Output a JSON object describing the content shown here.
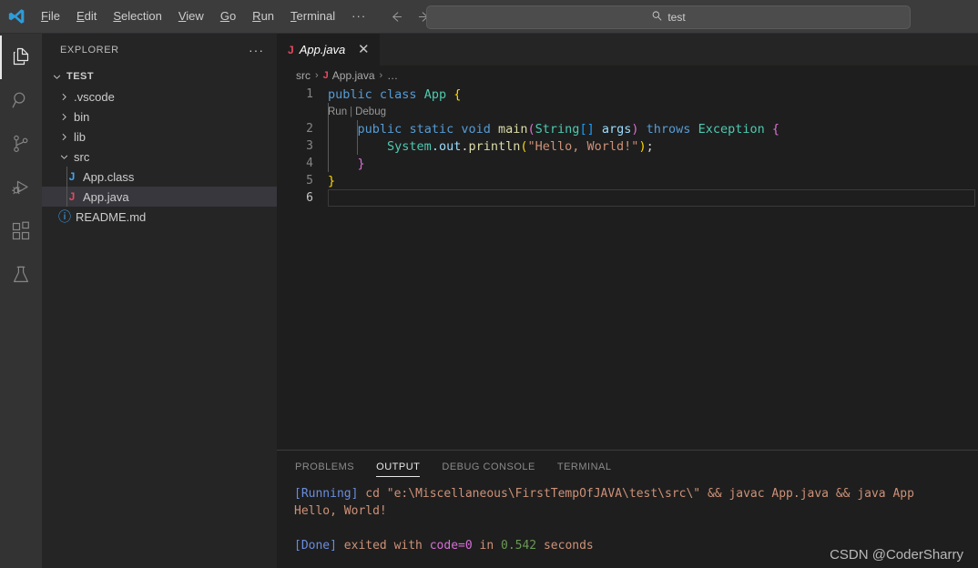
{
  "titlebar": {
    "logo_icon": "vscode-logo-icon",
    "menus": [
      {
        "label": "File",
        "accel": "F",
        "rest": "ile"
      },
      {
        "label": "Edit",
        "accel": "E",
        "rest": "dit"
      },
      {
        "label": "Selection",
        "accel": "S",
        "rest": "election"
      },
      {
        "label": "View",
        "accel": "V",
        "rest": "iew"
      },
      {
        "label": "Go",
        "accel": "G",
        "rest": "o"
      },
      {
        "label": "Run",
        "accel": "R",
        "rest": "un"
      },
      {
        "label": "Terminal",
        "accel": "T",
        "rest": "erminal"
      }
    ],
    "more_label": "···",
    "back_icon": "arrow-left-icon",
    "forward_icon": "arrow-right-icon",
    "search": {
      "icon": "search-icon",
      "value": "test",
      "placeholder": "Search"
    }
  },
  "activitybar": {
    "items": [
      {
        "name": "explorer",
        "icon": "files-icon",
        "active": true
      },
      {
        "name": "search",
        "icon": "search-icon",
        "active": false
      },
      {
        "name": "source-control",
        "icon": "source-control-icon",
        "active": false
      },
      {
        "name": "run-and-debug",
        "icon": "run-debug-icon",
        "active": false
      },
      {
        "name": "extensions",
        "icon": "extensions-icon",
        "active": false
      },
      {
        "name": "testing",
        "icon": "beaker-icon",
        "active": false
      }
    ]
  },
  "sidebar": {
    "title": "EXPLORER",
    "more_actions_label": "···",
    "tree": [
      {
        "label": "TEST",
        "type": "folder-root",
        "expanded": true,
        "depth": 0,
        "icon": "chevron-down-icon"
      },
      {
        "label": ".vscode",
        "type": "folder",
        "expanded": false,
        "depth": 1,
        "icon": "chevron-right-icon"
      },
      {
        "label": "bin",
        "type": "folder",
        "expanded": false,
        "depth": 1,
        "icon": "chevron-right-icon"
      },
      {
        "label": "lib",
        "type": "folder",
        "expanded": false,
        "depth": 1,
        "icon": "chevron-right-icon"
      },
      {
        "label": "src",
        "type": "folder",
        "expanded": true,
        "depth": 1,
        "icon": "chevron-down-icon"
      },
      {
        "label": "App.class",
        "type": "file-class",
        "depth": 2,
        "icon": "java-class-icon",
        "icon_text": "J",
        "selected": false
      },
      {
        "label": "App.java",
        "type": "file-java",
        "depth": 2,
        "icon": "java-file-icon",
        "icon_text": "J",
        "selected": true
      },
      {
        "label": "README.md",
        "type": "file-md",
        "depth": 1,
        "icon": "info-circle-icon",
        "icon_text": "ⓘ",
        "selected": false
      }
    ]
  },
  "editor": {
    "tab": {
      "label": "App.java",
      "icon": "java-file-icon",
      "icon_text": "J",
      "close_icon": "close-icon",
      "close_glyph": "✕",
      "preview": true
    },
    "breadcrumbs": {
      "folder": "src",
      "sep1": "›",
      "file_icon_text": "J",
      "file": "App.java",
      "sep2": "›",
      "more": "…"
    },
    "codelens": {
      "run": "Run",
      "separator": "|",
      "debug": "Debug"
    },
    "line_numbers": [
      "1",
      "2",
      "3",
      "4",
      "5",
      "6"
    ],
    "active_line": "6",
    "code": {
      "l1": {
        "kw_public": "public",
        "sp1": " ",
        "kw_class": "class",
        "sp2": " ",
        "type_app": "App",
        "sp3": " ",
        "brace": "{"
      },
      "l2": {
        "indent": "    ",
        "kw_public": "public",
        "sp1": " ",
        "kw_static": "static",
        "sp2": " ",
        "kw_void": "void",
        "sp3": " ",
        "fn_main": "main",
        "paren_open": "(",
        "type_string": "String",
        "brackets": "[]",
        "sp4": " ",
        "var_args": "args",
        "paren_close": ")",
        "sp5": " ",
        "kw_throws": "throws",
        "sp6": " ",
        "type_exception": "Exception",
        "sp7": " ",
        "brace": "{"
      },
      "l3": {
        "indent": "        ",
        "type_system": "System",
        "dot_out": ".out",
        "dot": ".",
        "fn_println": "println",
        "paren_open": "(",
        "str": "\"Hello, World!\"",
        "paren_close": ")",
        "semi": ";"
      },
      "l4": {
        "indent": "    ",
        "brace": "}"
      },
      "l5": {
        "brace": "}"
      },
      "l6": {
        "text": ""
      }
    }
  },
  "panel": {
    "tabs": [
      {
        "label": "PROBLEMS",
        "active": false
      },
      {
        "label": "OUTPUT",
        "active": true
      },
      {
        "label": "DEBUG CONSOLE",
        "active": false
      },
      {
        "label": "TERMINAL",
        "active": false
      }
    ],
    "output": {
      "running_tag": "[Running]",
      "running_cmd": " cd \"e:\\Miscellaneous\\FirstTempOfJAVA\\test\\src\\\" && javac App.java && java App",
      "program_output": "Hello, World!",
      "blank": "",
      "done_tag": "[Done]",
      "done_mid1": " exited with ",
      "done_code": "code=0",
      "done_mid2": " in ",
      "done_time": "0.542",
      "done_suffix": " seconds"
    }
  },
  "watermark": "CSDN @CoderSharry",
  "colors": {
    "titlebar_bg": "#3c3c3c",
    "activitybar_bg": "#333333",
    "sidebar_bg": "#252526",
    "editor_bg": "#1e1e1e",
    "selection_bg": "#37373d",
    "accent_keyword": "#569cd6",
    "accent_type": "#4ec9b0",
    "accent_function": "#dcdcaa",
    "accent_string": "#ce9178",
    "accent_variable": "#9cdcfe",
    "java_red": "#e8485e",
    "java_blue": "#3fa9f5",
    "output_tag": "#6a8ddf",
    "output_number": "#6a9955",
    "output_code": "#d670d6"
  }
}
